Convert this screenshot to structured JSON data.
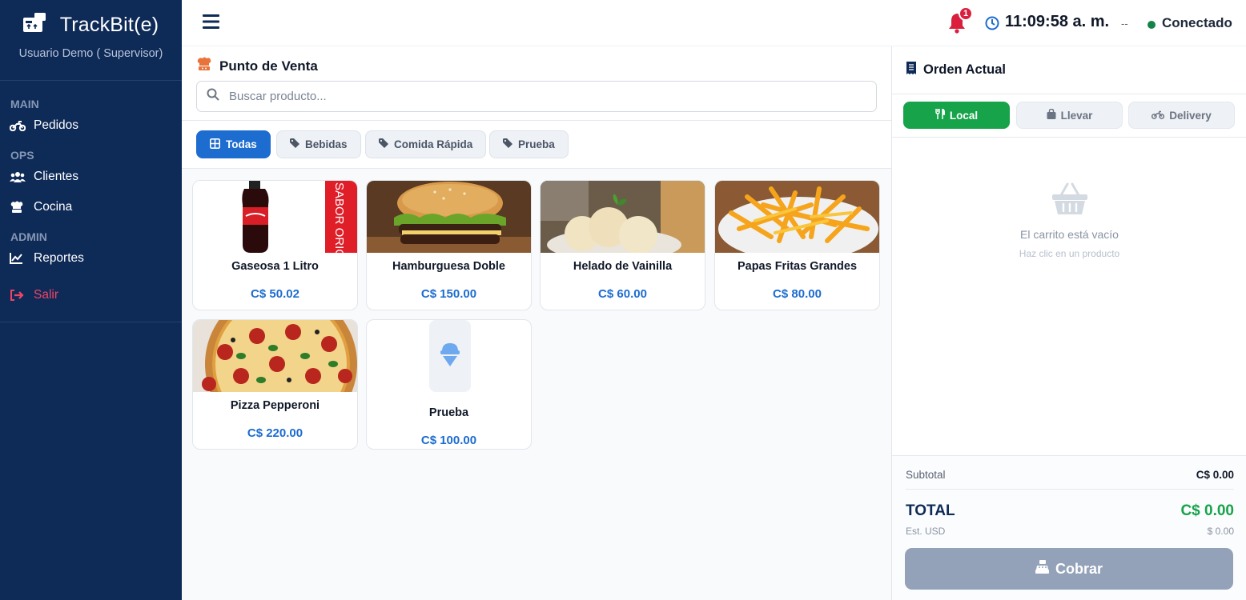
{
  "app": {
    "title": "TrackBit(e)",
    "user": "Usuario Demo ( Supervisor)"
  },
  "sidebar": {
    "sections": [
      {
        "label": "MAIN",
        "items": [
          {
            "label": "Pedidos",
            "icon": "motorcycle-icon"
          }
        ]
      },
      {
        "label": "OPS",
        "items": [
          {
            "label": "Clientes",
            "icon": "users-icon"
          },
          {
            "label": "Cocina",
            "icon": "chef-icon"
          }
        ]
      },
      {
        "label": "ADMIN",
        "items": [
          {
            "label": "Reportes",
            "icon": "chart-line-icon"
          }
        ]
      }
    ],
    "logout_label": "Salir"
  },
  "topbar": {
    "notifications_count": "1",
    "time": "11:09:58 a. m.",
    "time_suffix": "--",
    "status": "Conectado"
  },
  "main": {
    "title": "Punto de Venta",
    "search_placeholder": "Buscar producto...",
    "categories": [
      {
        "label": "Todas",
        "active": true
      },
      {
        "label": "Bebidas"
      },
      {
        "label": "Comida Rápida"
      },
      {
        "label": "Prueba"
      }
    ],
    "products": [
      {
        "name": "Gaseosa 1 Litro",
        "price": "C$ 50.02",
        "image_text": "SABOR ORIG"
      },
      {
        "name": "Hamburguesa Doble",
        "price": "C$ 150.00"
      },
      {
        "name": "Helado de Vainilla",
        "price": "C$ 60.00"
      },
      {
        "name": "Papas Fritas Grandes",
        "price": "C$ 80.00"
      },
      {
        "name": "Pizza Pepperoni",
        "price": "C$ 220.00"
      },
      {
        "name": "Prueba",
        "price": "C$ 100.00"
      }
    ]
  },
  "order": {
    "title": "Orden Actual",
    "types": [
      {
        "label": "Local",
        "active": true
      },
      {
        "label": "Llevar"
      },
      {
        "label": "Delivery"
      }
    ],
    "empty_title": "El carrito está vacío",
    "empty_sub": "Haz clic en un producto",
    "subtotal_label": "Subtotal",
    "subtotal_value": "C$ 0.00",
    "total_label": "TOTAL",
    "total_value": "C$ 0.00",
    "usd_label": "Est. USD",
    "usd_value": "$ 0.00",
    "charge_label": "Cobrar"
  },
  "colors": {
    "sidebar": "#0e2a57",
    "primary": "#1d6cd0",
    "success": "#16a34a",
    "danger": "#d91f3d"
  }
}
